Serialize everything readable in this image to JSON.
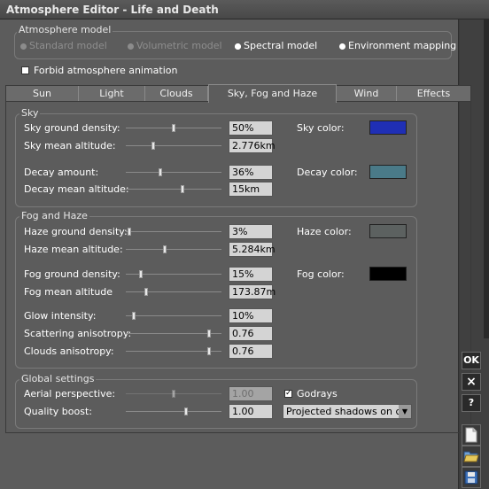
{
  "window": {
    "title": "Atmosphere Editor - Life and Death"
  },
  "atmosphere_model": {
    "legend": "Atmosphere model",
    "options": [
      {
        "label": "Standard model",
        "enabled": false,
        "selected": false
      },
      {
        "label": "Volumetric model",
        "enabled": false,
        "selected": false
      },
      {
        "label": "Spectral model",
        "enabled": true,
        "selected": true
      },
      {
        "label": "Environment mapping",
        "enabled": true,
        "selected": false
      }
    ]
  },
  "forbid_animation": {
    "label": "Forbid atmosphere animation",
    "checked": false
  },
  "tabs": [
    {
      "label": "Sun",
      "active": false
    },
    {
      "label": "Light",
      "active": false
    },
    {
      "label": "Clouds",
      "active": false
    },
    {
      "label": "Sky, Fog and Haze",
      "active": true
    },
    {
      "label": "Wind",
      "active": false
    },
    {
      "label": "Effects",
      "active": false
    }
  ],
  "sky": {
    "legend": "Sky",
    "ground_density": {
      "label": "Sky ground density:",
      "value": "50%",
      "slider": 0.5
    },
    "mean_altitude": {
      "label": "Sky mean altitude:",
      "value": "2.776km",
      "slider": 0.28
    },
    "decay_amount": {
      "label": "Decay amount:",
      "value": "36%",
      "slider": 0.36
    },
    "decay_mean_altitude": {
      "label": "Decay mean altitude:",
      "value": "15km",
      "slider": 0.6
    },
    "sky_color": {
      "label": "Sky color:",
      "color": "#1f2fb5"
    },
    "decay_color": {
      "label": "Decay color:",
      "color": "#4a7a88"
    }
  },
  "fog": {
    "legend": "Fog and Haze",
    "haze_density": {
      "label": "Haze ground density:",
      "value": "3%",
      "slider": 0.02
    },
    "haze_altitude": {
      "label": "Haze mean altitude:",
      "value": "5.284km",
      "slider": 0.4
    },
    "fog_density": {
      "label": "Fog ground density:",
      "value": "15%",
      "slider": 0.14
    },
    "fog_altitude": {
      "label": "Fog mean altitude",
      "value": "173.87m",
      "slider": 0.2
    },
    "glow": {
      "label": "Glow intensity:",
      "value": "10%",
      "slider": 0.07
    },
    "scattering": {
      "label": "Scattering anisotropy:",
      "value": "0.76",
      "slider": 0.88
    },
    "clouds_aniso": {
      "label": "Clouds anisotropy:",
      "value": "0.76",
      "slider": 0.88
    },
    "haze_color": {
      "label": "Haze color:",
      "color": "#5c6160"
    },
    "fog_color": {
      "label": "Fog color:",
      "color": "#000000"
    }
  },
  "global": {
    "legend": "Global settings",
    "aerial": {
      "label": "Aerial perspective:",
      "value": "1.00",
      "slider": 0.5,
      "enabled": false
    },
    "quality": {
      "label": "Quality boost:",
      "value": "1.00",
      "slider": 0.63
    },
    "godrays": {
      "label": "Godrays",
      "checked": true
    },
    "shadows": {
      "label": "Projected shadows on clouds"
    }
  },
  "side_buttons": {
    "ok": "OK",
    "cancel": "×",
    "help": "?"
  }
}
